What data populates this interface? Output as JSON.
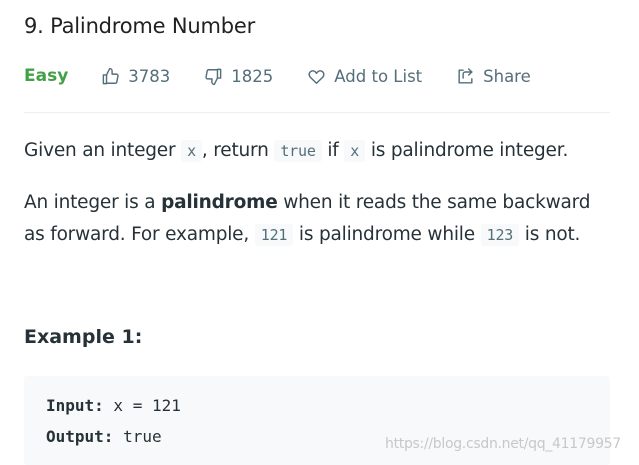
{
  "problem": {
    "title": "9. Palindrome Number",
    "difficulty": "Easy",
    "likes": "3783",
    "dislikes": "1825",
    "add_to_list": "Add to List",
    "share": "Share"
  },
  "description": {
    "p1": {
      "t1": "Given an integer ",
      "c1": "x",
      "t2": ", return ",
      "c2": "true",
      "t3": " if ",
      "c3": "x",
      "t4": " is palindrome integer."
    },
    "p2": {
      "t1": "An integer is a ",
      "bold": "palindrome",
      "t2": " when it reads the same backward as forward. For example, ",
      "c1": "121",
      "t3": " is palindrome while ",
      "c2": "123",
      "t4": " is not."
    }
  },
  "example": {
    "title": "Example 1:",
    "input_label": "Input:",
    "input_value": " x = 121",
    "output_label": "Output:",
    "output_value": " true"
  },
  "watermark": "https://blog.csdn.net/qq_41179957",
  "colors": {
    "easy": "#43a047",
    "text": "#263238",
    "muted": "#546e7a",
    "code_bg": "#f7f9fa"
  },
  "icons": {
    "like": "thumbs-up-icon",
    "dislike": "thumbs-down-icon",
    "add_to_list": "heart-icon",
    "share": "share-icon"
  }
}
